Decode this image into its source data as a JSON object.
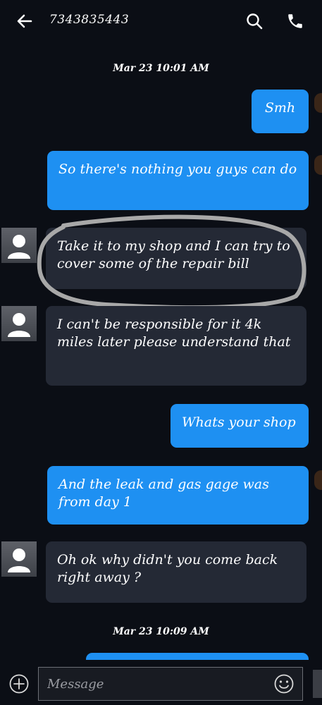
{
  "header": {
    "contact_number": "7343835443",
    "back_icon": "arrow-left-icon",
    "search_icon": "search-icon",
    "call_icon": "phone-icon"
  },
  "timestamps": [
    "Mar 23 10:01 AM",
    "Mar 23 10:09 AM"
  ],
  "messages": [
    {
      "direction": "outgoing",
      "text": "Smh"
    },
    {
      "direction": "outgoing",
      "text": "So there's nothing you guys can do"
    },
    {
      "direction": "incoming",
      "text": "Take it to my shop and I can try to cover some of the repair bill"
    },
    {
      "direction": "incoming",
      "text": "I can't be responsible for it 4k miles later please understand that"
    },
    {
      "direction": "outgoing",
      "text": "Whats your shop"
    },
    {
      "direction": "outgoing",
      "text": "And the leak and gas gage was from day 1"
    },
    {
      "direction": "incoming",
      "text": "Oh ok why didn't you come back right  away ?"
    }
  ],
  "composer": {
    "placeholder": "Message",
    "add_icon": "plus-circle-icon",
    "emoji_icon": "emoji-icon"
  },
  "colors": {
    "background": "#0b0e15",
    "outgoing_bubble": "#1e90f2",
    "incoming_bubble": "#242935",
    "annotation": "#a8a8a8"
  }
}
